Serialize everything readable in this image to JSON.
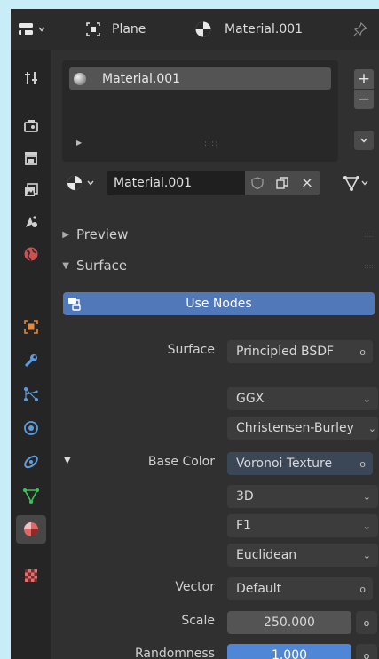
{
  "header": {
    "object_name": "Plane",
    "material_name": "Material.001"
  },
  "slot_list": {
    "items": [
      {
        "label": "Material.001"
      }
    ],
    "grip": "::::",
    "add_label": "+",
    "remove_label": "−"
  },
  "material_selector": {
    "name": "Material.001",
    "unlink_label": "×"
  },
  "panels": {
    "preview_label": "Preview",
    "surface_label": "Surface",
    "use_nodes_label": "Use Nodes"
  },
  "surface": {
    "surface_label": "Surface",
    "surface_value": "Principled BSDF",
    "distribution": "GGX",
    "subsurface_method": "Christensen-Burley",
    "base_color_label": "Base Color",
    "base_color_value": "Voronoi Texture",
    "dimensions": "3D",
    "feature": "F1",
    "distance": "Euclidean",
    "vector_label": "Vector",
    "vector_value": "Default",
    "scale_label": "Scale",
    "scale_value": "250.000",
    "scale_fill": 1.0,
    "randomness_label": "Randomness",
    "randomness_value": "1.000",
    "randomness_fill": 1.0
  },
  "colors": {
    "accent_blue": "#5178b8",
    "panel_bg": "#303030",
    "outer_bg": "#c9ecf9",
    "active_tab": "#e06766"
  },
  "icons": [
    "editor-type-icon",
    "object-data-icon",
    "material-sphere-icon",
    "pin-icon",
    "tool-icon",
    "render-icon",
    "output-icon",
    "view-layer-icon",
    "scene-icon",
    "world-icon",
    "object-icon",
    "modifier-icon",
    "particles-icon",
    "physics-icon",
    "constraints-icon",
    "object-data-mesh-icon",
    "material-icon",
    "texture-icon",
    "shield-icon",
    "duplicate-icon",
    "node-tree-icon"
  ]
}
